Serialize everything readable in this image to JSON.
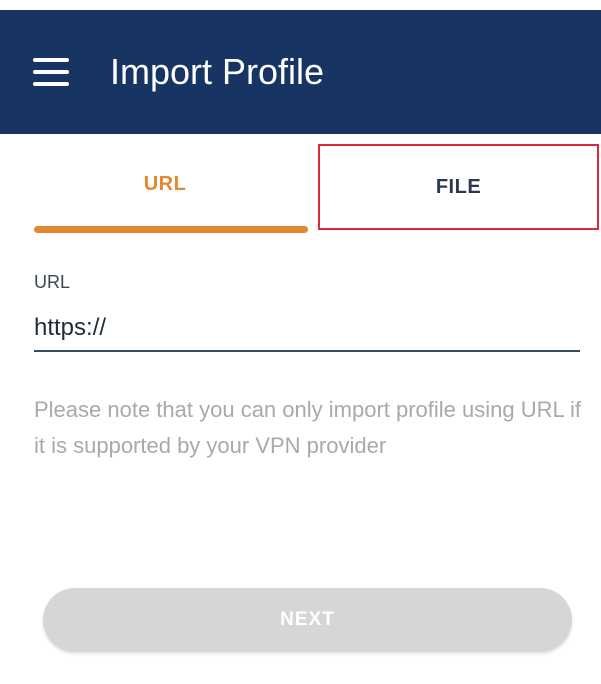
{
  "appbar": {
    "title": "Import Profile",
    "menu_icon": "hamburger-menu-icon",
    "background": "#173463"
  },
  "tabs": [
    {
      "label": "URL",
      "selected": true
    },
    {
      "label": "FILE",
      "selected": false
    }
  ],
  "colors": {
    "accent": "#e3882e",
    "highlight_box": "#d9293d",
    "button_disabled": "#d6d6d6"
  },
  "form": {
    "url_label": "URL",
    "url_value": "https://"
  },
  "note": "Please note that you can only import profile using URL if it is supported by your VPN provider",
  "next_button": {
    "label": "NEXT",
    "enabled": false
  }
}
